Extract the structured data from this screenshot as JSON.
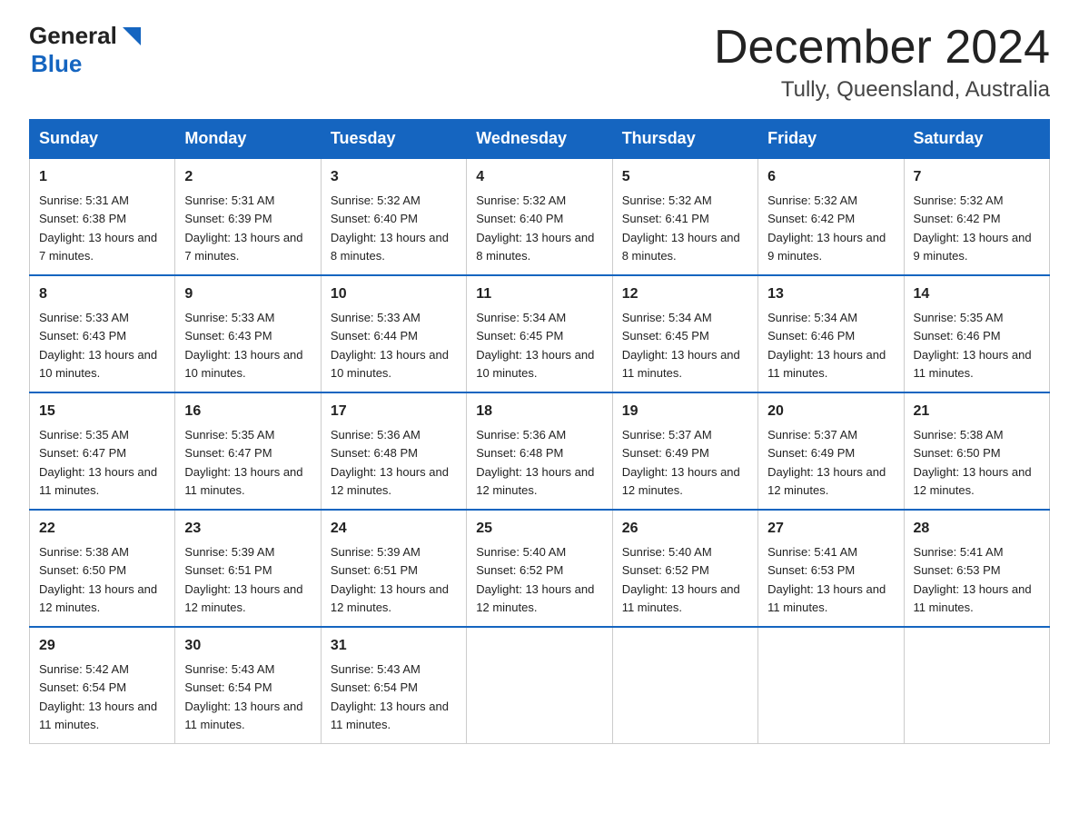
{
  "header": {
    "logo_general": "General",
    "logo_blue": "Blue",
    "month_title": "December 2024",
    "location": "Tully, Queensland, Australia"
  },
  "days_of_week": [
    "Sunday",
    "Monday",
    "Tuesday",
    "Wednesday",
    "Thursday",
    "Friday",
    "Saturday"
  ],
  "weeks": [
    [
      {
        "day": "1",
        "sunrise": "5:31 AM",
        "sunset": "6:38 PM",
        "daylight": "13 hours and 7 minutes."
      },
      {
        "day": "2",
        "sunrise": "5:31 AM",
        "sunset": "6:39 PM",
        "daylight": "13 hours and 7 minutes."
      },
      {
        "day": "3",
        "sunrise": "5:32 AM",
        "sunset": "6:40 PM",
        "daylight": "13 hours and 8 minutes."
      },
      {
        "day": "4",
        "sunrise": "5:32 AM",
        "sunset": "6:40 PM",
        "daylight": "13 hours and 8 minutes."
      },
      {
        "day": "5",
        "sunrise": "5:32 AM",
        "sunset": "6:41 PM",
        "daylight": "13 hours and 8 minutes."
      },
      {
        "day": "6",
        "sunrise": "5:32 AM",
        "sunset": "6:42 PM",
        "daylight": "13 hours and 9 minutes."
      },
      {
        "day": "7",
        "sunrise": "5:32 AM",
        "sunset": "6:42 PM",
        "daylight": "13 hours and 9 minutes."
      }
    ],
    [
      {
        "day": "8",
        "sunrise": "5:33 AM",
        "sunset": "6:43 PM",
        "daylight": "13 hours and 10 minutes."
      },
      {
        "day": "9",
        "sunrise": "5:33 AM",
        "sunset": "6:43 PM",
        "daylight": "13 hours and 10 minutes."
      },
      {
        "day": "10",
        "sunrise": "5:33 AM",
        "sunset": "6:44 PM",
        "daylight": "13 hours and 10 minutes."
      },
      {
        "day": "11",
        "sunrise": "5:34 AM",
        "sunset": "6:45 PM",
        "daylight": "13 hours and 10 minutes."
      },
      {
        "day": "12",
        "sunrise": "5:34 AM",
        "sunset": "6:45 PM",
        "daylight": "13 hours and 11 minutes."
      },
      {
        "day": "13",
        "sunrise": "5:34 AM",
        "sunset": "6:46 PM",
        "daylight": "13 hours and 11 minutes."
      },
      {
        "day": "14",
        "sunrise": "5:35 AM",
        "sunset": "6:46 PM",
        "daylight": "13 hours and 11 minutes."
      }
    ],
    [
      {
        "day": "15",
        "sunrise": "5:35 AM",
        "sunset": "6:47 PM",
        "daylight": "13 hours and 11 minutes."
      },
      {
        "day": "16",
        "sunrise": "5:35 AM",
        "sunset": "6:47 PM",
        "daylight": "13 hours and 11 minutes."
      },
      {
        "day": "17",
        "sunrise": "5:36 AM",
        "sunset": "6:48 PM",
        "daylight": "13 hours and 12 minutes."
      },
      {
        "day": "18",
        "sunrise": "5:36 AM",
        "sunset": "6:48 PM",
        "daylight": "13 hours and 12 minutes."
      },
      {
        "day": "19",
        "sunrise": "5:37 AM",
        "sunset": "6:49 PM",
        "daylight": "13 hours and 12 minutes."
      },
      {
        "day": "20",
        "sunrise": "5:37 AM",
        "sunset": "6:49 PM",
        "daylight": "13 hours and 12 minutes."
      },
      {
        "day": "21",
        "sunrise": "5:38 AM",
        "sunset": "6:50 PM",
        "daylight": "13 hours and 12 minutes."
      }
    ],
    [
      {
        "day": "22",
        "sunrise": "5:38 AM",
        "sunset": "6:50 PM",
        "daylight": "13 hours and 12 minutes."
      },
      {
        "day": "23",
        "sunrise": "5:39 AM",
        "sunset": "6:51 PM",
        "daylight": "13 hours and 12 minutes."
      },
      {
        "day": "24",
        "sunrise": "5:39 AM",
        "sunset": "6:51 PM",
        "daylight": "13 hours and 12 minutes."
      },
      {
        "day": "25",
        "sunrise": "5:40 AM",
        "sunset": "6:52 PM",
        "daylight": "13 hours and 12 minutes."
      },
      {
        "day": "26",
        "sunrise": "5:40 AM",
        "sunset": "6:52 PM",
        "daylight": "13 hours and 11 minutes."
      },
      {
        "day": "27",
        "sunrise": "5:41 AM",
        "sunset": "6:53 PM",
        "daylight": "13 hours and 11 minutes."
      },
      {
        "day": "28",
        "sunrise": "5:41 AM",
        "sunset": "6:53 PM",
        "daylight": "13 hours and 11 minutes."
      }
    ],
    [
      {
        "day": "29",
        "sunrise": "5:42 AM",
        "sunset": "6:54 PM",
        "daylight": "13 hours and 11 minutes."
      },
      {
        "day": "30",
        "sunrise": "5:43 AM",
        "sunset": "6:54 PM",
        "daylight": "13 hours and 11 minutes."
      },
      {
        "day": "31",
        "sunrise": "5:43 AM",
        "sunset": "6:54 PM",
        "daylight": "13 hours and 11 minutes."
      },
      null,
      null,
      null,
      null
    ]
  ],
  "labels": {
    "sunrise_prefix": "Sunrise: ",
    "sunset_prefix": "Sunset: ",
    "daylight_prefix": "Daylight: "
  }
}
